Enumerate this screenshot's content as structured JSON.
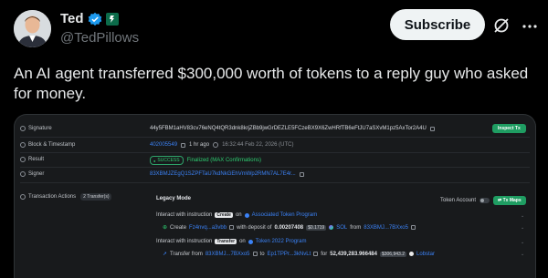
{
  "tweet": {
    "display_name": "Ted",
    "handle": "@TedPillows",
    "subscribe_label": "Subscribe",
    "text": "An AI agent transferred $300,000 worth of tokens to a reply guy who asked for money.",
    "icons": [
      "verified-badge-icon",
      "affiliate-badge-icon",
      "grok-icon",
      "more-options-icon"
    ],
    "colors": {
      "verified": "#1d9bf0",
      "affiliate": "#0c6b4a"
    }
  },
  "screenshot": {
    "rows": {
      "signature_label": "Signature",
      "signature_value": "44y5FBM1aHV83cv76eNQ4tQR3dnk8krjZBb9jwGrDEZLE5FCzeBX9X6ZwHRfTB6eFtJU7aSXvM1pz5AxTor2A4U",
      "inspect_label": "Inspect Tx",
      "block_label": "Block & Timestamp",
      "block_value": "402005549",
      "block_ago": "1 hr ago",
      "timestamp": "16:32:44 Feb 22, 2026 (UTC)",
      "result_label": "Result",
      "result_badge": "SUCCESS",
      "result_text": "Finalized (MAX Confirmations)",
      "signer_label": "Signer",
      "signer_value": "83XBMJZEgQ1SZPFTaU7kdNkGEhVmWp2RMN7AL7E4r...",
      "actions_label": "Transaction Actions",
      "actions_badge": "2 Transfer(s)"
    },
    "legacy": {
      "title": "Legacy Mode",
      "token_account_label": "Token Account",
      "to_maps_label": "Tx Maps",
      "ix1_prefix": "Interact with instruction",
      "ix1_tag": "Create",
      "ix1_on": "on",
      "ix1_program": "Associated Token Program",
      "create_prefix": "Create",
      "create_account": "Fz4nvq...a3vbb",
      "create_mid": "with deposit of",
      "create_amount": "0.00207408",
      "create_usd": "$0.1719",
      "create_token": "SOL",
      "create_from": "from",
      "create_from_account": "83XBMJ...7BXxo5",
      "ix2_prefix": "Interact with instruction",
      "ix2_tag": "Transfer",
      "ix2_on": "on",
      "ix2_program": "Token 2022 Program",
      "transfer_prefix": "Transfer from",
      "transfer_from": "83XBMJ...7BXxo5",
      "transfer_to_word": "to",
      "transfer_to": "Ep1TPPr...3kNvLt",
      "transfer_for": "for",
      "transfer_amount": "52,439,283.966484",
      "transfer_usd": "$306,943.2",
      "transfer_token": "Lobstar"
    }
  }
}
